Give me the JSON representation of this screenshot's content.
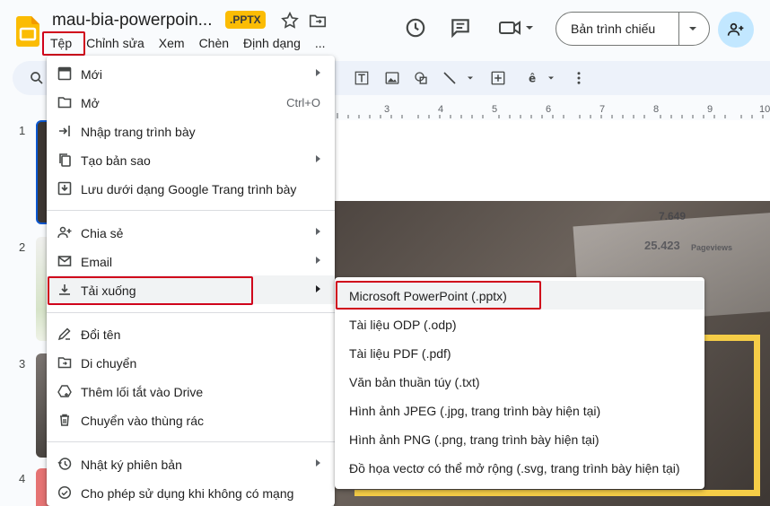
{
  "header": {
    "doc_title": "mau-bia-powerpoin...",
    "file_ext": ".PPTX",
    "present_label": "Bản trình chiếu"
  },
  "menubar": {
    "items": [
      "Tệp",
      "Chỉnh sửa",
      "Xem",
      "Chèn",
      "Định dạng",
      "..."
    ]
  },
  "file_menu": {
    "items": [
      {
        "label": "Mới",
        "icon": "plus-box-icon",
        "submenu": true
      },
      {
        "label": "Mở",
        "icon": "folder-icon",
        "shortcut": "Ctrl+O"
      },
      {
        "label": "Nhập trang trình bày",
        "icon": "import-icon"
      },
      {
        "label": "Tạo bản sao",
        "icon": "copy-icon",
        "submenu": true
      },
      {
        "label": "Lưu dưới dạng Google Trang trình bày",
        "icon": "save-icon"
      },
      {
        "label": "Chia sẻ",
        "icon": "person-add-icon",
        "submenu": true
      },
      {
        "label": "Email",
        "icon": "mail-icon",
        "submenu": true
      },
      {
        "label": "Tải xuống",
        "icon": "download-icon",
        "submenu": true
      },
      {
        "label": "Đổi tên",
        "icon": "pencil-icon"
      },
      {
        "label": "Di chuyển",
        "icon": "move-folder-icon"
      },
      {
        "label": "Thêm lối tắt vào Drive",
        "icon": "drive-shortcut-icon"
      },
      {
        "label": "Chuyển vào thùng rác",
        "icon": "trash-icon"
      },
      {
        "label": "Nhật ký phiên bản",
        "icon": "history-icon",
        "submenu": true
      },
      {
        "label": "Cho phép sử dụng khi không có mạng",
        "icon": "offline-icon"
      }
    ]
  },
  "download_menu": {
    "items": [
      "Microsoft PowerPoint (.pptx)",
      "Tài liệu ODP (.odp)",
      "Tài liệu PDF (.pdf)",
      "Văn bản thuần túy (.txt)",
      "Hình ảnh JPEG (.jpg, trang trình bày hiện tại)",
      "Hình ảnh PNG (.png, trang trình bày hiện tại)",
      "Đồ họa vectơ có thể mở rộng (.svg, trang trình bày hiện tại)"
    ]
  },
  "filmstrip": {
    "numbers": [
      "1",
      "2",
      "3",
      "4"
    ]
  },
  "ruler": {
    "ticks": [
      "3",
      "4",
      "5",
      "6",
      "7",
      "8",
      "9",
      "10"
    ]
  },
  "slide": {
    "text_1": "7.649",
    "text_2": "25.423",
    "text_3": "Pageviews"
  },
  "colors": {
    "accent_red": "#d0021b",
    "frame_yellow": "#f5cd47",
    "share_blue": "#c2e7ff"
  }
}
